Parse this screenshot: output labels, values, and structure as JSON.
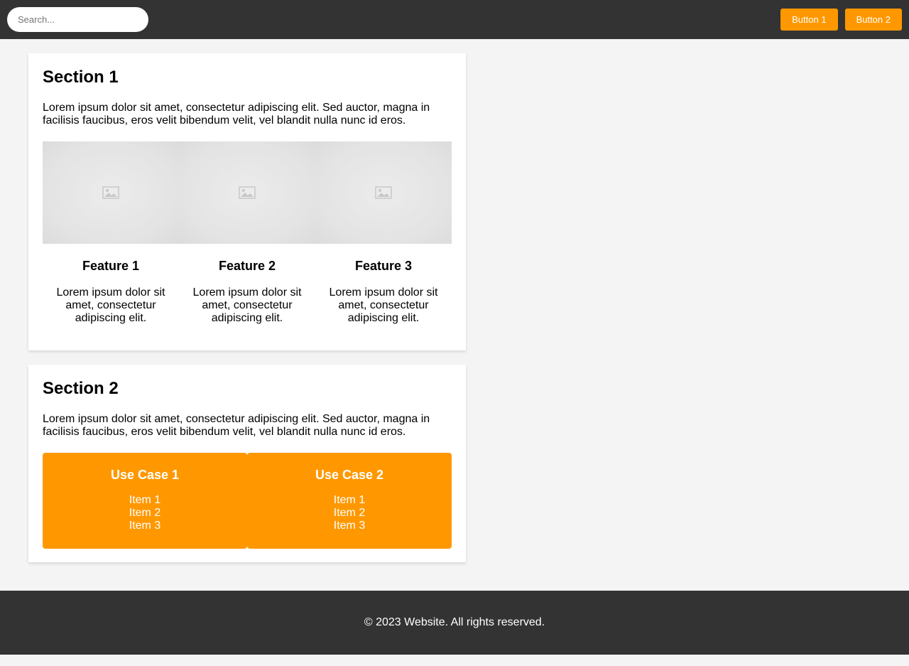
{
  "header": {
    "search_placeholder": "Search...",
    "button1_label": "Button 1",
    "button2_label": "Button 2"
  },
  "section1": {
    "title": "Section 1",
    "intro": "Lorem ipsum dolor sit amet, consectetur adipiscing elit. Sed auctor, magna in facilisis faucibus, eros velit bibendum velit, vel blandit nulla nunc id eros.",
    "features": [
      {
        "title": "Feature 1",
        "text": "Lorem ipsum dolor sit amet, consectetur adipiscing elit.",
        "image_icon": "image-placeholder-icon"
      },
      {
        "title": "Feature 2",
        "text": "Lorem ipsum dolor sit amet, consectetur adipiscing elit.",
        "image_icon": "image-placeholder-icon"
      },
      {
        "title": "Feature 3",
        "text": "Lorem ipsum dolor sit amet, consectetur adipiscing elit.",
        "image_icon": "image-placeholder-icon"
      }
    ]
  },
  "section2": {
    "title": "Section 2",
    "intro": "Lorem ipsum dolor sit amet, consectetur adipiscing elit. Sed auctor, magna in facilisis faucibus, eros velit bibendum velit, vel blandit nulla nunc id eros.",
    "usecases": [
      {
        "title": "Use Case 1",
        "items": [
          "Item 1",
          "Item 2",
          "Item 3"
        ]
      },
      {
        "title": "Use Case 2",
        "items": [
          "Item 1",
          "Item 2",
          "Item 3"
        ]
      }
    ]
  },
  "footer": {
    "text": "© 2023 Website. All rights reserved."
  },
  "colors": {
    "header_bg": "#333333",
    "accent": "#ff9800",
    "page_bg": "#f4f4f4",
    "card_bg": "#ffffff"
  }
}
